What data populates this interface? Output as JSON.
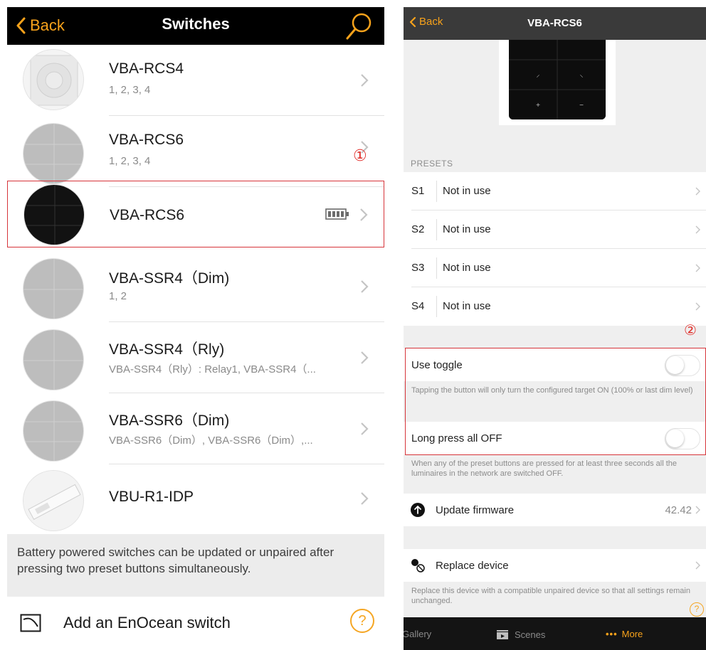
{
  "left": {
    "nav": {
      "back_label": "Back",
      "title": "Switches"
    },
    "items": [
      {
        "name": "VBA-RCS4",
        "sub": "1, 2, 3, 4"
      },
      {
        "name": "VBA-RCS6",
        "sub": "1, 2, 3, 4"
      },
      {
        "name": "VBA-RCS6",
        "sub": ""
      },
      {
        "name": "VBA-SSR4（Dim)",
        "sub": "1, 2"
      },
      {
        "name": "VBA-SSR4（Rly)",
        "sub": "VBA-SSR4（Rly）: Relay1, VBA-SSR4（..."
      },
      {
        "name": "VBA-SSR6（Dim)",
        "sub": "VBA-SSR6（Dim）, VBA-SSR6（Dim）,..."
      },
      {
        "name": "VBU-R1-IDP",
        "sub": ""
      }
    ],
    "marker": "①",
    "note": "Battery powered switches can be updated or unpaired after pressing two preset buttons simultaneously.",
    "add_label": "Add an EnOcean switch",
    "help_glyph": "?"
  },
  "right": {
    "nav": {
      "back_label": "Back",
      "title": "VBA-RCS6"
    },
    "section_header": "PRESETS",
    "presets": [
      {
        "key": "S1",
        "value": "Not in use"
      },
      {
        "key": "S2",
        "value": "Not in use"
      },
      {
        "key": "S3",
        "value": "Not in use"
      },
      {
        "key": "S4",
        "value": "Not in use"
      }
    ],
    "marker": "②",
    "use_toggle": {
      "label": "Use toggle",
      "state": false
    },
    "use_toggle_help": "Tapping the button will only turn the configured target ON (100% or last dim level)",
    "long_press": {
      "label": "Long press all OFF",
      "state": false
    },
    "long_press_help": "When any of the preset buttons are pressed for at least three seconds all the luminaires in the network are switched OFF.",
    "update": {
      "label": "Update firmware",
      "value": "42.42"
    },
    "replace": {
      "label": "Replace device"
    },
    "replace_help": "Replace this device with a compatible unpaired device so that all settings remain unchanged.",
    "help_glyph": "?",
    "tabs": {
      "gallery": "Gallery",
      "scenes": "Scenes",
      "more": "More"
    }
  },
  "colors": {
    "accent": "#f7a21b",
    "highlight": "#d6343a"
  }
}
